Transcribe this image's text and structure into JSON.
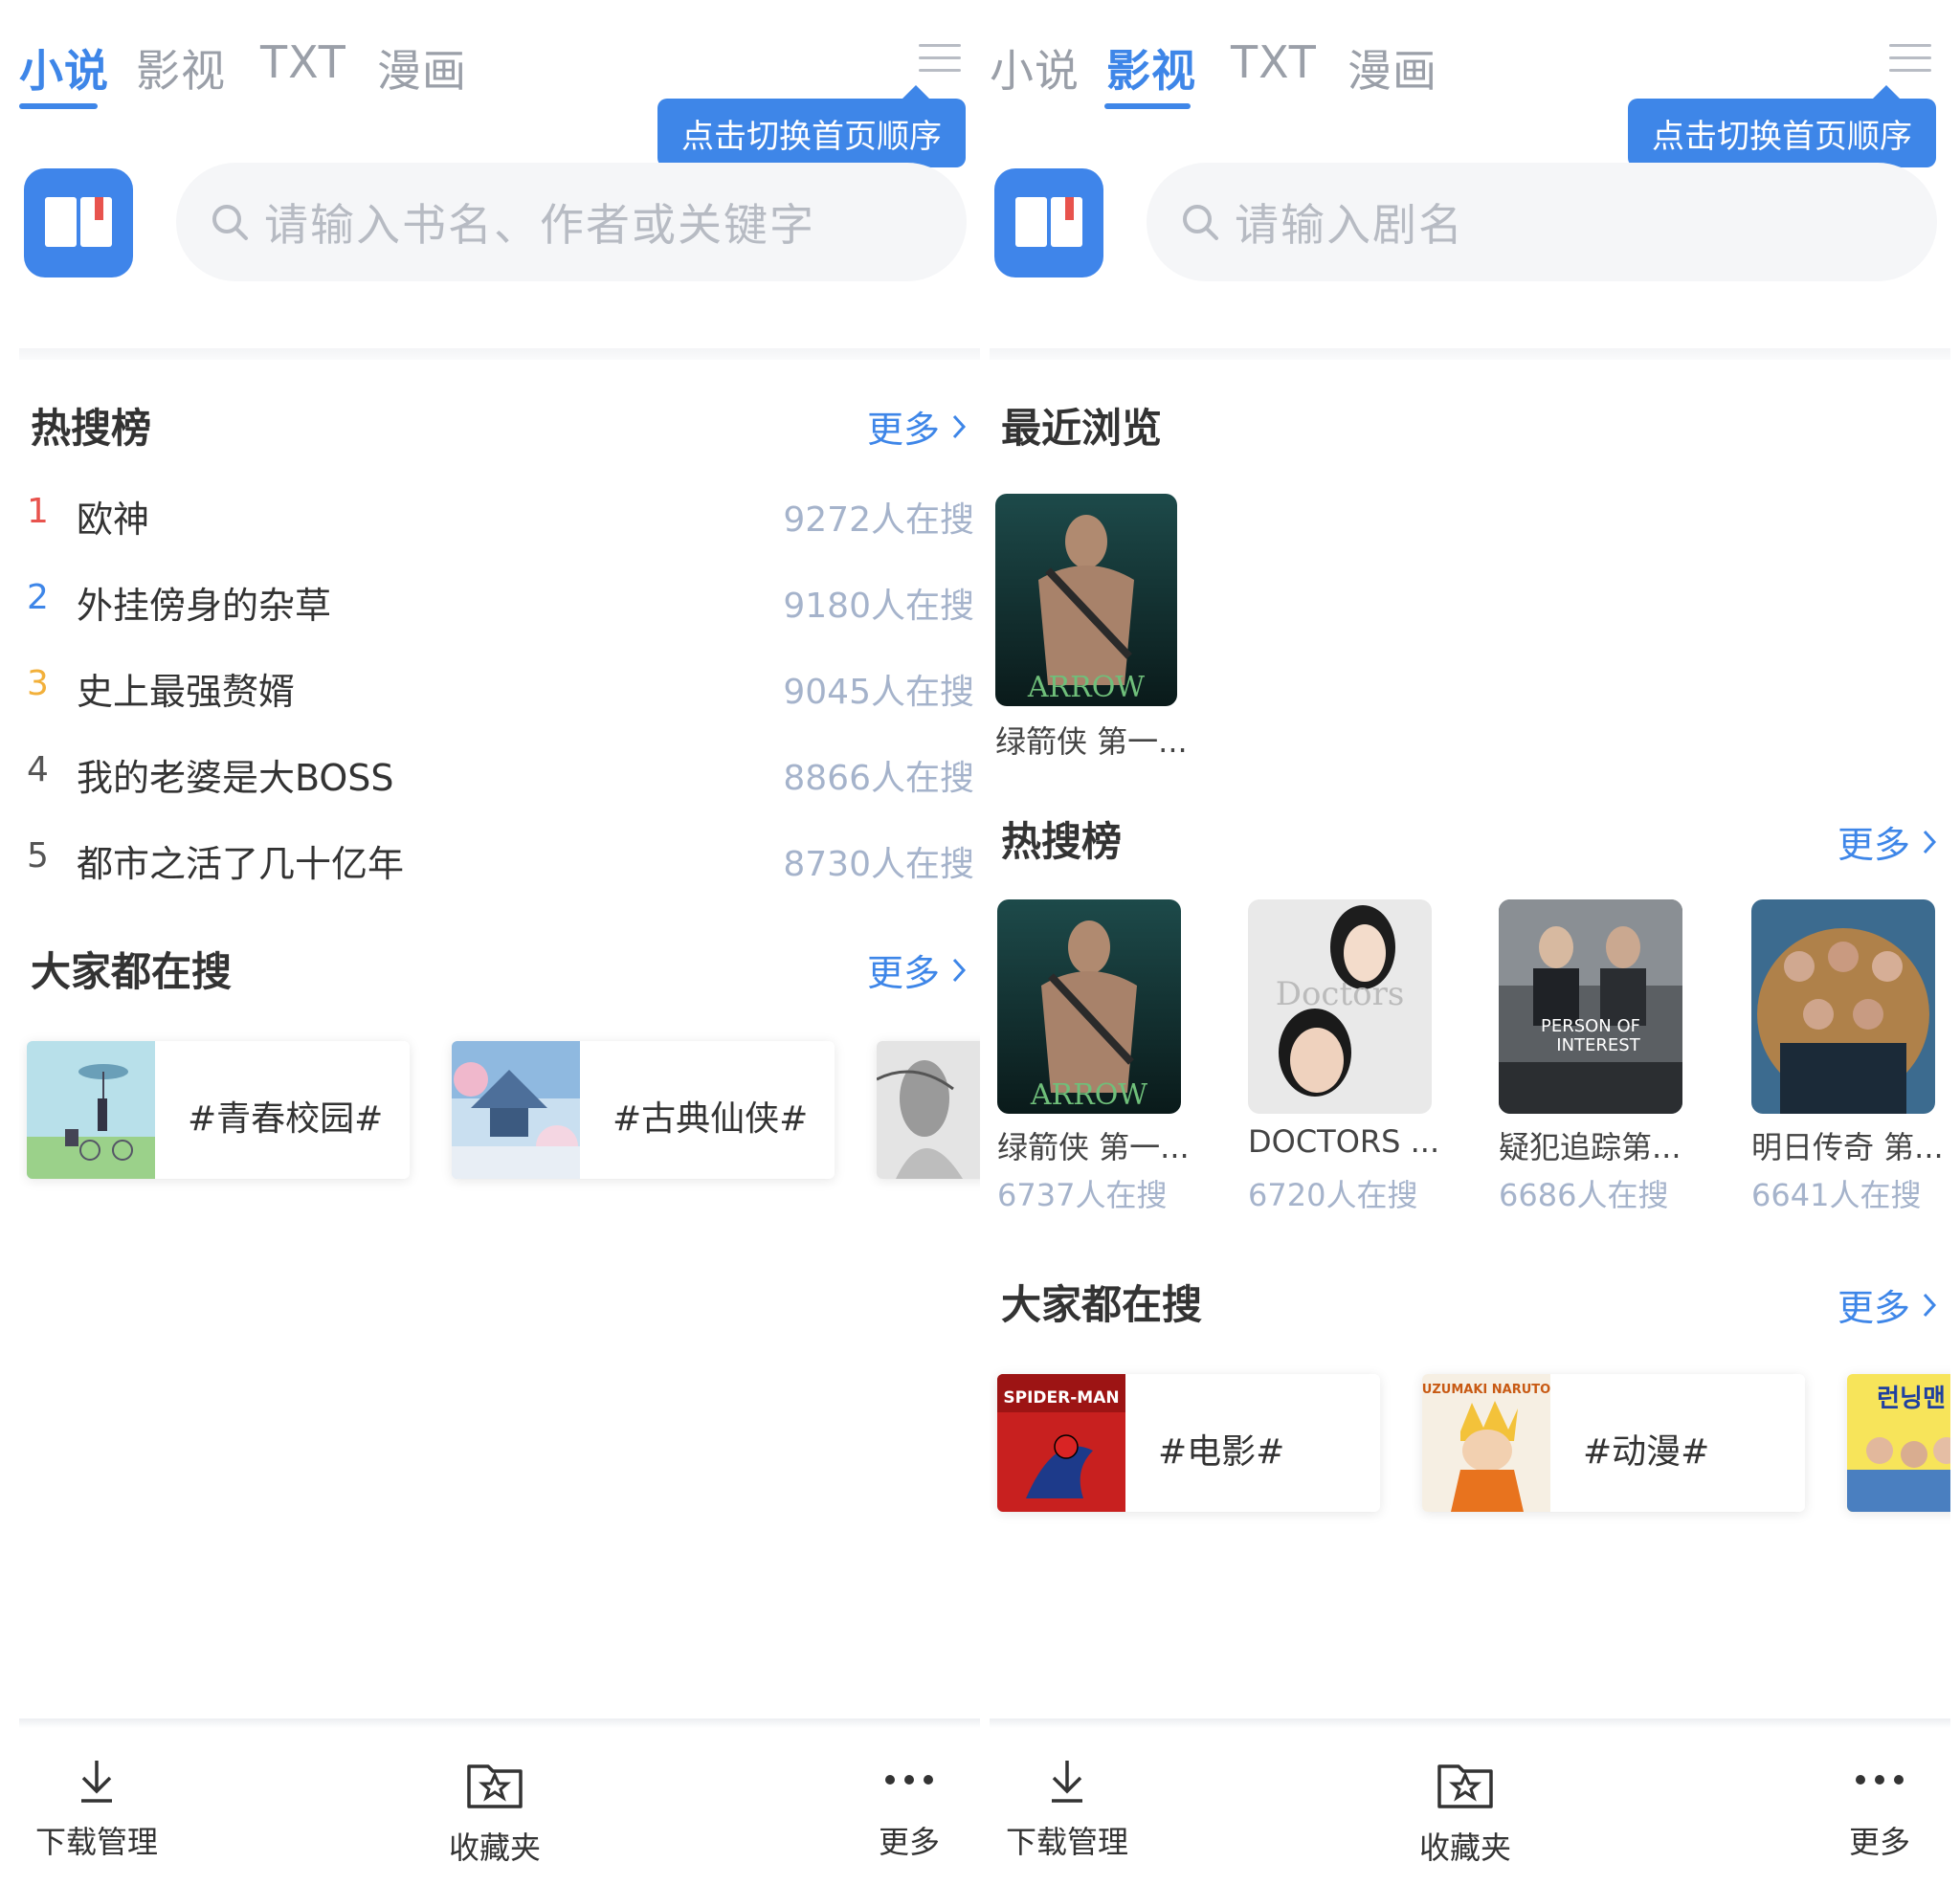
{
  "left": {
    "tabs": [
      "小说",
      "影视",
      "TXT",
      "漫画"
    ],
    "active_tab": "小说",
    "tooltip": "点击切换首页顺序",
    "search_placeholder": "请输入书名、作者或关键字",
    "hot_title": "热搜榜",
    "more": "更多",
    "hot_list": [
      {
        "rank": "1",
        "name": "欧神",
        "count": "9272人在搜",
        "color": "#e8534d"
      },
      {
        "rank": "2",
        "name": "外挂傍身的杂草",
        "count": "9180人在搜",
        "color": "#3e86e8"
      },
      {
        "rank": "3",
        "name": "史上最强赘婿",
        "count": "9045人在搜",
        "color": "#f2b03a"
      },
      {
        "rank": "4",
        "name": "我的老婆是大BOSS",
        "count": "8866人在搜",
        "color": "#555555"
      },
      {
        "rank": "5",
        "name": "都市之活了几十亿年",
        "count": "8730人在搜",
        "color": "#555555"
      }
    ],
    "everyone_title": "大家都在搜",
    "tags": [
      "#青春校园#",
      "#古典仙侠#"
    ]
  },
  "right": {
    "tabs": [
      "小说",
      "影视",
      "TXT",
      "漫画"
    ],
    "active_tab": "影视",
    "tooltip": "点击切换首页顺序",
    "search_placeholder": "请输入剧名",
    "recent_title": "最近浏览",
    "recent": [
      {
        "title": "绿箭侠 第一..."
      }
    ],
    "hot_title": "热搜榜",
    "more": "更多",
    "hot": [
      {
        "title": "绿箭侠 第一...",
        "count": "6737人在搜"
      },
      {
        "title": "DOCTORS ...",
        "count": "6720人在搜"
      },
      {
        "title": "疑犯追踪第...",
        "count": "6686人在搜"
      },
      {
        "title": "明日传奇 第...",
        "count": "6641人在搜"
      }
    ],
    "poster_texts": {
      "arrow": "ARROW",
      "doctors": "Doctors",
      "poi_1": "PERSON OF",
      "poi_2": "INTEREST",
      "spider": "SPIDER-MAN",
      "naruto": "UZUMAKI NARUTO",
      "running": "런닝맨"
    },
    "everyone_title": "大家都在搜",
    "tags": [
      "#电影#",
      "#动漫#"
    ]
  },
  "bottom": {
    "download": "下载管理",
    "favorites": "收藏夹",
    "more": "更多"
  },
  "colors": {
    "accent": "#3e86e8",
    "count_text": "#a5b3cb",
    "rank1": "#e8534d",
    "rank3": "#f2b03a"
  },
  "icons": [
    "menu-icon",
    "book-icon",
    "search-icon",
    "chevron-right-icon",
    "download-icon",
    "star-folder-icon",
    "more-dots-icon"
  ]
}
